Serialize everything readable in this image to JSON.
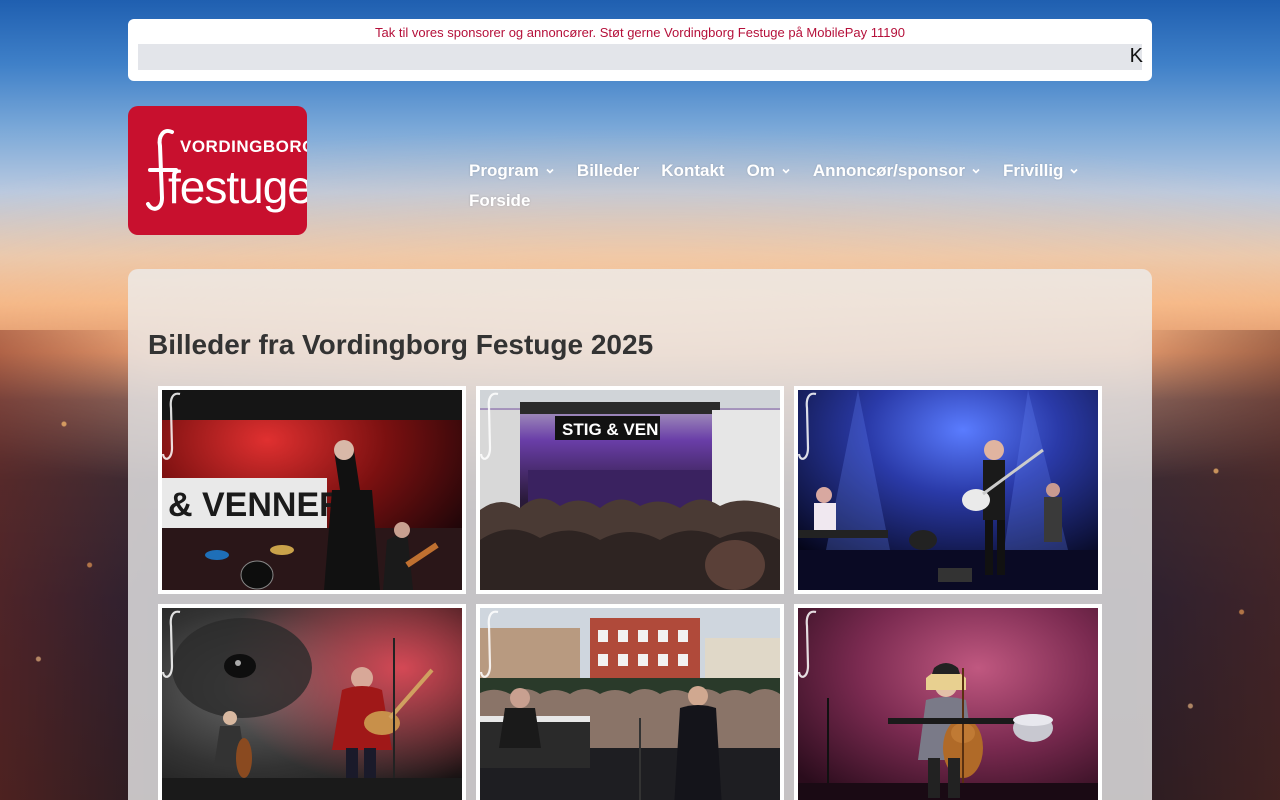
{
  "notice": {
    "text": "Tak til vores sponsorer og annoncører. Støt gerne Vordingborg Festuge på MobilePay 11190",
    "close_label": "K"
  },
  "logo": {
    "line1": "VORDINGBORG",
    "line2": "festuge",
    "color": "#c8102e"
  },
  "nav": {
    "items": [
      {
        "label": "Program",
        "dropdown": true
      },
      {
        "label": "Billeder",
        "dropdown": false
      },
      {
        "label": "Kontakt",
        "dropdown": false
      },
      {
        "label": "Om",
        "dropdown": true
      },
      {
        "label": "Annoncør/sponsor",
        "dropdown": true
      },
      {
        "label": "Frivillig",
        "dropdown": true
      },
      {
        "label": "Forside",
        "dropdown": false
      }
    ]
  },
  "page": {
    "title": "Billeder fra Vordingborg Festuge 2025"
  },
  "gallery": {
    "photos": [
      {
        "scene": "red-stage-venner"
      },
      {
        "scene": "crowd-stage-purple"
      },
      {
        "scene": "blue-stage-guitar"
      },
      {
        "scene": "gorilla-backdrop-guitar"
      },
      {
        "scene": "town-square-crowd"
      },
      {
        "scene": "pink-stage-cello"
      }
    ]
  },
  "photo_texts": {
    "venner": "& VENNER",
    "stig": "STIG & VEN"
  },
  "colors": {
    "accent": "#c8102e",
    "notice_text": "#b5103a",
    "title_text": "#333333"
  }
}
